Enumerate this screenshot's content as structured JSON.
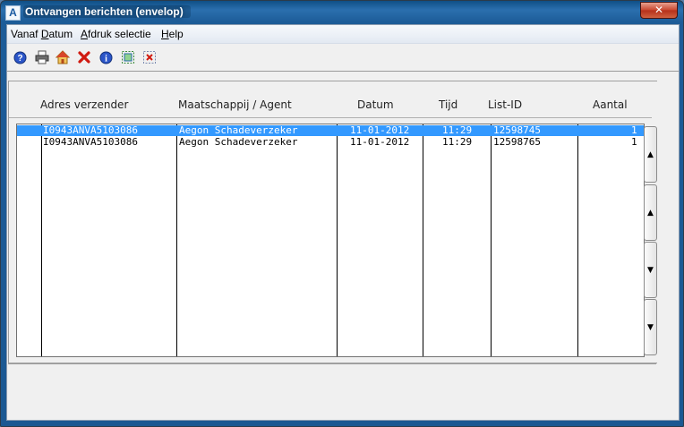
{
  "window": {
    "title": "Ontvangen berichten (envelop)",
    "app_icon_letter": "A",
    "close_glyph": "✕"
  },
  "menu": [
    {
      "pre": "Vanaf ",
      "accel": "D",
      "post": "atum"
    },
    {
      "pre": "",
      "accel": "A",
      "post": "fdruk selectie"
    },
    {
      "pre": "",
      "accel": "H",
      "post": "elp"
    }
  ],
  "toolbar": {
    "icons": [
      "help-icon",
      "print-icon",
      "home-icon",
      "delete-icon",
      "info-icon",
      "select-icon",
      "clear-selection-icon"
    ]
  },
  "columns": {
    "adres": "Adres verzender",
    "maatschappij": "Maatschappij / Agent",
    "datum": "Datum",
    "tijd": "Tijd",
    "list_id": "List-ID",
    "aantal": "Aantal"
  },
  "rows": [
    {
      "adres": "I0943ANVA5103086",
      "maatschappij": "Aegon Schadeverzeker",
      "datum": "11-01-2012",
      "tijd": "11:29",
      "list_id": "12598745",
      "aantal": "1",
      "selected": true
    },
    {
      "adres": "I0943ANVA5103086",
      "maatschappij": "Aegon Schadeverzeker",
      "datum": "11-01-2012",
      "tijd": "11:29",
      "list_id": "12598765",
      "aantal": "1",
      "selected": false
    }
  ],
  "scroll_buttons": {
    "top": "▲",
    "page_up": "▲",
    "page_down": "▼",
    "bottom": "▼"
  },
  "colors": {
    "selection": "#3399ff",
    "title_bar": "#1d5c98",
    "close_button": "#c9452d"
  }
}
